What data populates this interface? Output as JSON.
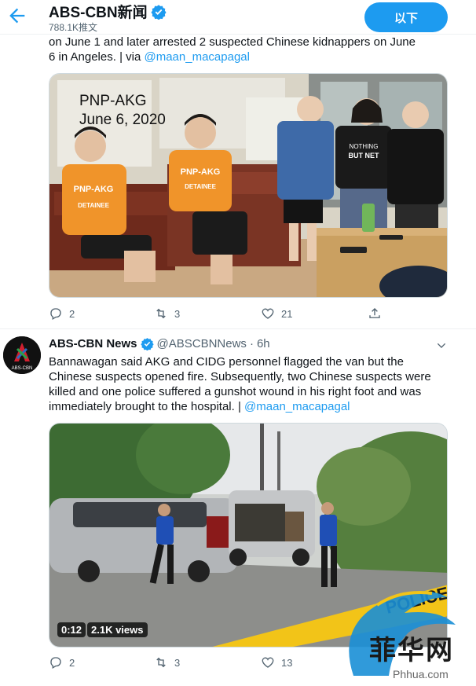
{
  "header": {
    "account_name": "ABS-CBN新闻",
    "tweet_count": "788.1K推文",
    "follow_label": "以下"
  },
  "tweet1": {
    "text_line1": "on June 1 and later arrested 2 suspected Chinese kidnappers on June",
    "text_line2_prefix": "6 in Angeles. | via ",
    "mention": "@maan_macapagal",
    "photo_overlay_line1": "PNP-AKG",
    "photo_overlay_line2": "June 6, 2020",
    "shirt_text": "PNP-AKG",
    "shirt_text2": "DETAINEE",
    "tshirt_text1": "NOTHING",
    "tshirt_text2": "BUT NET",
    "replies": "2",
    "retweets": "3",
    "likes": "21"
  },
  "tweet2": {
    "name": "ABS-CBN News",
    "handle": "@ABSCBNNews",
    "separator": "·",
    "time": "6h",
    "text": "Bannawagan said AKG and CIDG personnel flagged the van but the Chinese suspects opened fire. Subsequently, two Chinese suspects were killed and one police suffered a gunshot wound in his right foot and was immediately brought to the hospital. | ",
    "mention": "@maan_macapagal",
    "avatar_label": "ABS-CBN",
    "video_duration": "0:12",
    "video_views": "2.1K views",
    "tape_text": "POLICE",
    "replies": "2",
    "retweets": "3",
    "likes": "13"
  },
  "watermark": {
    "text": "菲华网",
    "url": "Phhua.com"
  },
  "colors": {
    "accent": "#1d9bf0",
    "text_primary": "#0f1419",
    "text_secondary": "#536471"
  }
}
